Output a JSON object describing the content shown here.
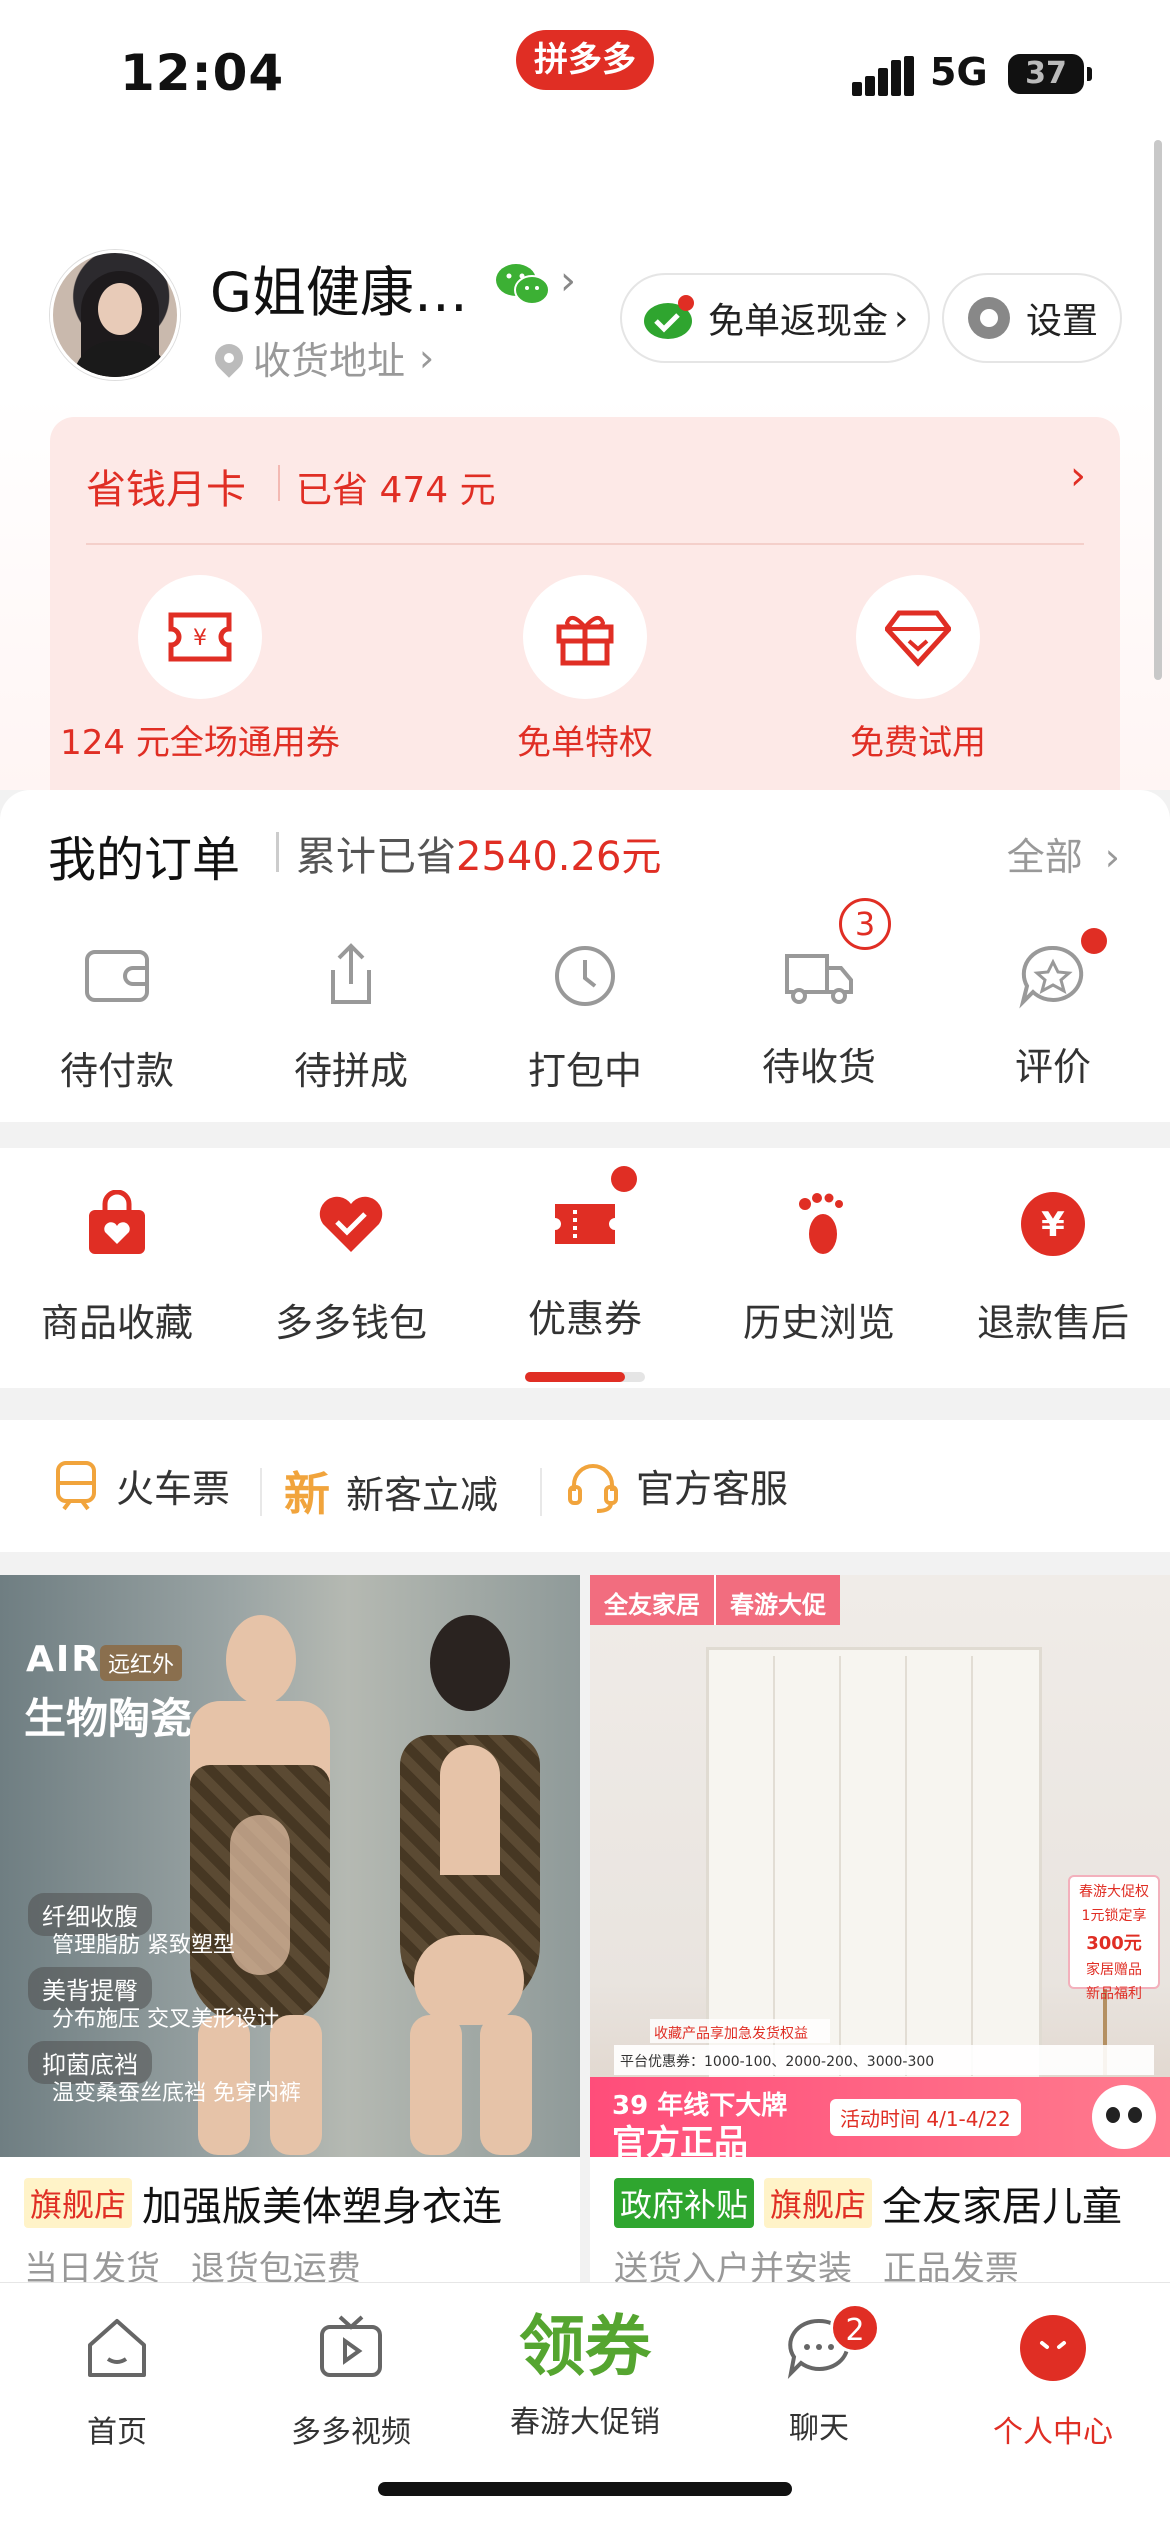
{
  "status_bar": {
    "time": "12:04",
    "app_logo": "拼多多",
    "network": "5G",
    "battery": "37"
  },
  "profile": {
    "username": "G姐健康…",
    "address_label": "收货地址",
    "cashback_label": "免单返现金",
    "settings_label": "设置"
  },
  "money_card": {
    "title": "省钱月卡",
    "saved": "已省 474 元",
    "perks": [
      {
        "label": "124 元全场通用券",
        "icon": "coupon-yen-icon"
      },
      {
        "label": "免单特权",
        "icon": "gift-icon"
      },
      {
        "label": "免费试用",
        "icon": "diamond-icon"
      }
    ]
  },
  "orders": {
    "title": "我的订单",
    "saved_prefix": "累计已省",
    "saved_value": "2540.26元",
    "all_label": "全部",
    "items": [
      {
        "label": "待付款",
        "icon": "wallet-icon"
      },
      {
        "label": "待拼成",
        "icon": "share-icon"
      },
      {
        "label": "打包中",
        "icon": "clock-icon"
      },
      {
        "label": "待收货",
        "icon": "truck-icon",
        "badge": "3"
      },
      {
        "label": "评价",
        "icon": "review-star-icon"
      }
    ]
  },
  "tools": {
    "items": [
      {
        "label": "商品收藏",
        "icon": "bag-heart-icon"
      },
      {
        "label": "多多钱包",
        "icon": "wallet-heart-icon"
      },
      {
        "label": "优惠券",
        "icon": "ticket-icon"
      },
      {
        "label": "历史浏览",
        "icon": "footprint-icon"
      },
      {
        "label": "退款售后",
        "icon": "refund-yen-icon"
      }
    ]
  },
  "services": {
    "items": [
      {
        "label": "火车票",
        "icon": "train-icon"
      },
      {
        "label": "新客立减",
        "icon": "new-icon",
        "icon_text": "新"
      },
      {
        "label": "官方客服",
        "icon": "headset-icon"
      }
    ]
  },
  "products": [
    {
      "tag": "旗舰店",
      "title": "加强版美体塑身衣连",
      "sub1": "当日发货",
      "sub2": "退货包运费",
      "img_air": "AIR",
      "img_air_sub": "远红外",
      "img_headline": "生物陶瓷",
      "img_tags": [
        "纤细收腹",
        "美背提臀",
        "抑菌底裆"
      ],
      "img_lines": [
        "管理脂肪 紧致塑型",
        "分布施压 交叉美形设计",
        "温变桑蚕丝底裆 免穿内裤"
      ]
    },
    {
      "tags": [
        "政府补贴",
        "旗舰店"
      ],
      "title": "全友家居儿童",
      "sub1": "送货入户并安装",
      "sub2": "正品发票",
      "img_brand": "全友家居",
      "img_event": "春游大促",
      "img_gift": [
        "春游大促权",
        "1元锁定享",
        "300元",
        "家居赠品",
        "新品福利"
      ],
      "img_bar1": "收藏产品享加急发货权益",
      "img_bar2": "平台优惠券：1000-100、2000-200、3000-300",
      "img_banner1": "39 年线下大牌",
      "img_banner2": "官方正品",
      "img_event_time": "活动时间 4/1-4/22"
    }
  ],
  "tabbar": {
    "items": [
      {
        "label": "首页",
        "icon": "home-icon"
      },
      {
        "label": "多多视频",
        "icon": "video-icon"
      },
      {
        "label": "春游大促销",
        "big": "领券"
      },
      {
        "label": "聊天",
        "icon": "chat-icon",
        "badge": "2"
      },
      {
        "label": "个人中心",
        "icon": "profile-icon",
        "active": true
      }
    ]
  },
  "colors": {
    "brand_red": "#e02e24",
    "coupon_green": "#55a530",
    "card_pink": "#fde9e7"
  }
}
